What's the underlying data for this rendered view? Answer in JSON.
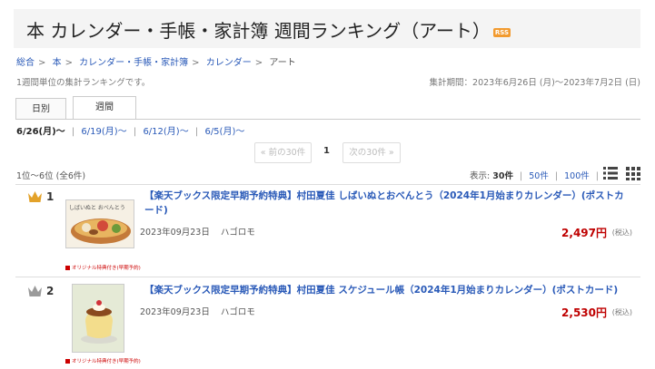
{
  "header": {
    "title": "本  カレンダー・手帳・家計簿  週間ランキング（アート）",
    "rss_label": "RSS"
  },
  "breadcrumb": [
    {
      "label": "総合"
    },
    {
      "label": "本"
    },
    {
      "label": "カレンダー・手帳・家計簿"
    },
    {
      "label": "カレンダー"
    },
    {
      "label": "アート"
    }
  ],
  "subtitle": "1週間単位の集計ランキングです。",
  "period": "集計期間：2023年6月26日 (月)～2023年7月2日 (日)",
  "tabs": {
    "daily": "日別",
    "weekly": "週間"
  },
  "weeks": {
    "current": "6/26(月)～",
    "others": [
      "6/19(月)～",
      "6/12(月)～",
      "6/5(月)～"
    ]
  },
  "pager": {
    "prev": "« 前の30件",
    "page": "1",
    "next": "次の30件 »"
  },
  "count": "1位～6位 (全6件)",
  "display": {
    "label": "表示:",
    "options": [
      "30件",
      "50件",
      "100件"
    ]
  },
  "items": [
    {
      "rank": "1",
      "title": "【楽天ブックス限定早期予約特典】村田夏佳 しばいぬとおべんとう（2024年1月始まりカレンダー）(ポストカード)",
      "date": "2023年09月23日",
      "publisher": "ハゴロモ",
      "price": "2,497円",
      "tax": "(税込)",
      "tag": "オリジナル特典付き(早期予約)",
      "cover_text": "しばいぬと おべんとう"
    },
    {
      "rank": "2",
      "title": "【楽天ブックス限定早期予約特典】村田夏佳 スケジュール帳（2024年1月始まりカレンダー）(ポストカード)",
      "date": "2023年09月23日",
      "publisher": "ハゴロモ",
      "price": "2,530円",
      "tax": "(税込)",
      "tag": "オリジナル特典付き(早期予約)",
      "cover_text": ""
    }
  ],
  "colors": {
    "accent_link": "#2a5ab8",
    "price": "#bf0000",
    "gold_crown": "#e3a22a",
    "silver_crown": "#9a9a9a",
    "rss": "#f29a2e"
  },
  "icons": [
    "crown-gold-icon",
    "crown-silver-icon",
    "list-view-icon",
    "grid-view-icon"
  ]
}
